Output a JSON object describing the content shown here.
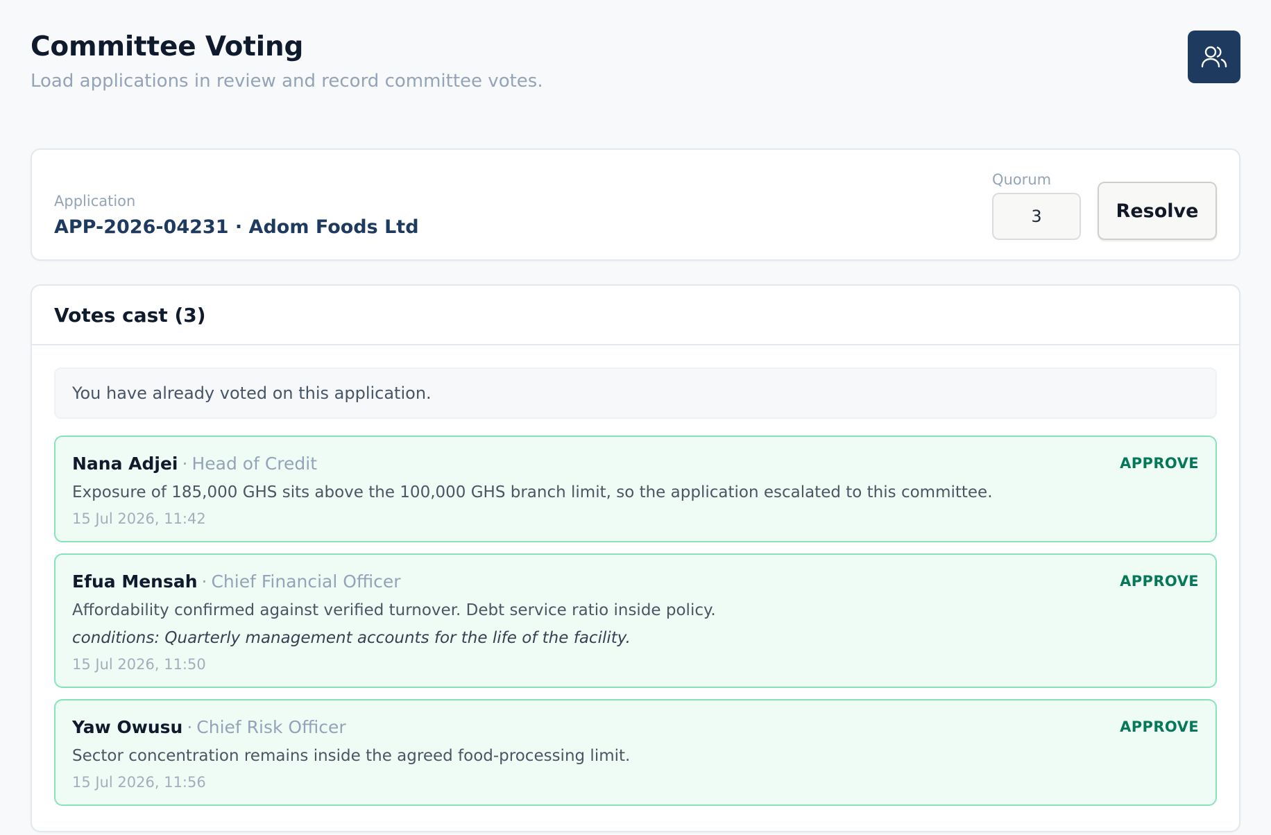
{
  "header": {
    "title": "Committee Voting",
    "subtitle": "Load applications in review and record committee votes.",
    "avatar_icon": "users-icon"
  },
  "application": {
    "label": "Application",
    "value": "APP-2026-04231 · Adom Foods Ltd",
    "quorum_label": "Quorum",
    "quorum_value": "3",
    "resolve_label": "Resolve"
  },
  "votes": {
    "title": "Votes cast (3)",
    "notice": "You have already voted on this application.",
    "items": [
      {
        "name": "Nana Adjei",
        "role": "Head of Credit",
        "decision": "APPROVE",
        "comment": "Exposure of 185,000 GHS sits above the 100,000 GHS branch limit, so the application escalated to this committee.",
        "time": "15 Jul 2026, 11:42"
      },
      {
        "name": "Efua Mensah",
        "role": "Chief Financial Officer",
        "decision": "APPROVE",
        "comment": "Affordability confirmed against verified turnover. Debt service ratio inside policy.",
        "conditions": "conditions: Quarterly management accounts for the life of the facility.",
        "time": "15 Jul 2026, 11:50"
      },
      {
        "name": "Yaw Owusu",
        "role": "Chief Risk Officer",
        "decision": "APPROVE",
        "comment": "Sector concentration remains inside the agreed food-processing limit.",
        "time": "15 Jul 2026, 11:56"
      }
    ]
  },
  "colors": {
    "accent": "#1e3a5f",
    "approve": "#047857",
    "approve_bg": "#effcf6",
    "approve_border": "#86e3b9"
  }
}
